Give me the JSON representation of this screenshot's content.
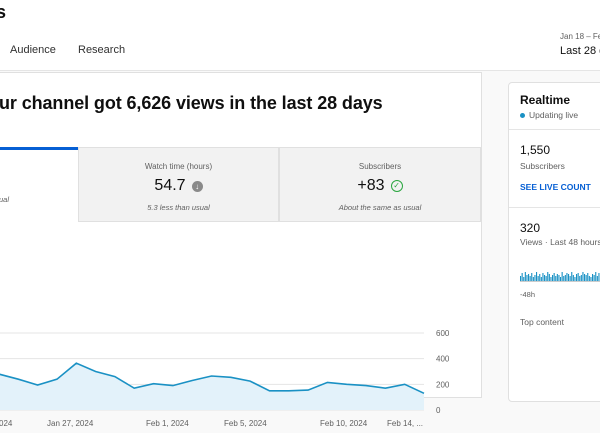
{
  "header": {
    "title_fragment": "s",
    "tabs": [
      "Audience",
      "Research"
    ],
    "date_range_top": "Jan 18 – Fe",
    "date_range_main": "Last 28 d"
  },
  "main": {
    "headline": "ur channel got 6,626 views in the last 28 days",
    "metrics": [
      {
        "label": "",
        "value": "",
        "note": "ual"
      },
      {
        "label": "Watch time (hours)",
        "value": "54.7",
        "note": "5.3 less than usual",
        "icon": "down-arrow-icon"
      },
      {
        "label": "Subscribers",
        "value": "+83",
        "note": "About the same as usual",
        "icon": "check-circle-icon"
      }
    ]
  },
  "chart_data": {
    "type": "area",
    "title": "",
    "x_tick_labels": [
      "024",
      "Jan 27, 2024",
      "Feb 1, 2024",
      "Feb 5, 2024",
      "Feb 10, 2024",
      "Feb 14, ..."
    ],
    "y_ticks": [
      0,
      200,
      400,
      600
    ],
    "ylim": [
      0,
      600
    ],
    "values": [
      280,
      240,
      195,
      240,
      365,
      300,
      260,
      170,
      205,
      190,
      230,
      265,
      255,
      225,
      150,
      150,
      155,
      215,
      200,
      190,
      170,
      200,
      130
    ],
    "color": "#1a91c4",
    "fill_color": "#e3f2fa",
    "grid": true
  },
  "realtime": {
    "title": "Realtime",
    "status": "Updating live",
    "subscribers_value": "1,550",
    "subscribers_label": "Subscribers",
    "live_count_link": "SEE LIVE COUNT",
    "views_value": "320",
    "views_label": "Views · Last 48 hours",
    "axis_label": "-48h",
    "top_content_label": "Top content",
    "bars": [
      5,
      8,
      4,
      9,
      6,
      7,
      5,
      8,
      4,
      6,
      9,
      5,
      7,
      4,
      8,
      6,
      5,
      9,
      7,
      4,
      6,
      8,
      5,
      7,
      6,
      4,
      9,
      5,
      6,
      8,
      7,
      5,
      9,
      6,
      4,
      7,
      8,
      5,
      6,
      9,
      7,
      6,
      8,
      5,
      4,
      7,
      6,
      9,
      5,
      8,
      7,
      6,
      8,
      5,
      9,
      6
    ]
  },
  "colors": {
    "accent": "#065fd4",
    "chart_line": "#1a91c4",
    "live_dot": "#1a91c4",
    "check": "#2ba640"
  }
}
